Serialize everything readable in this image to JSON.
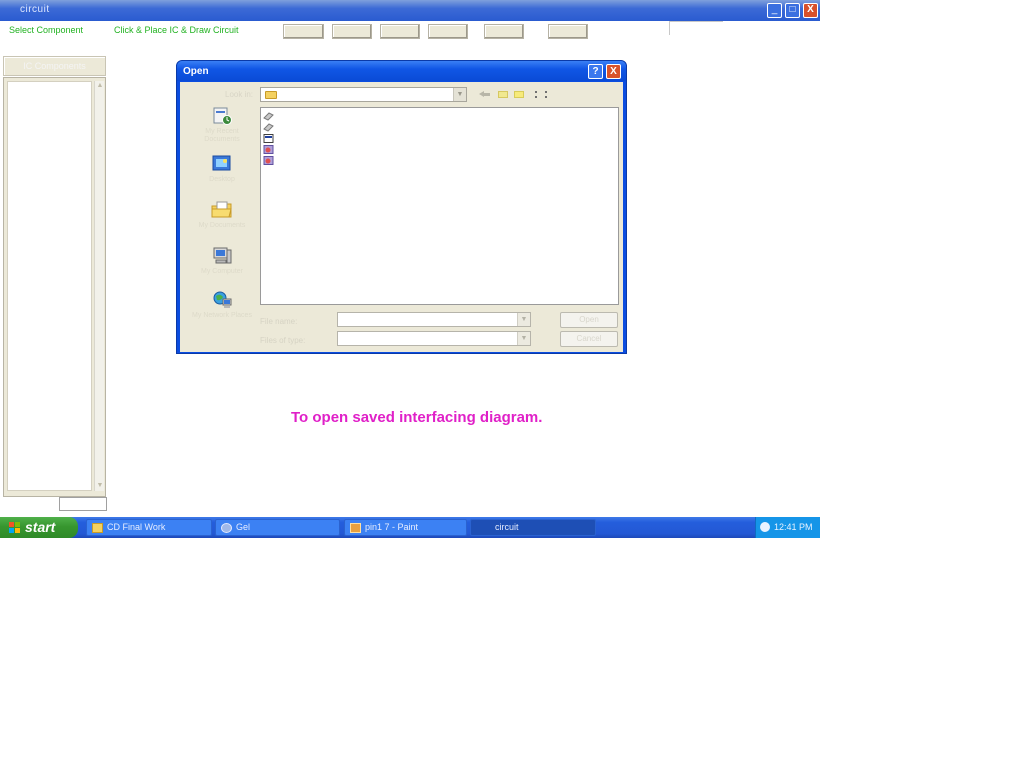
{
  "app": {
    "title": "circuit",
    "select_component_label": "Select Component",
    "click_place_label": "Click & Place IC & Draw Circuit",
    "left_panel_header": "IC Components",
    "min_glyph": "_",
    "max_glyph": "□",
    "close_glyph": "X"
  },
  "dialog": {
    "title": "Open",
    "help_glyph": "?",
    "close_glyph": "X",
    "look_in_label": "Look in:",
    "look_in_value": "",
    "places": [
      {
        "label": "My Recent Documents",
        "icon": "recent-documents-icon"
      },
      {
        "label": "Desktop",
        "icon": "desktop-icon"
      },
      {
        "label": "My Documents",
        "icon": "my-documents-icon"
      },
      {
        "label": "My Computer",
        "icon": "my-computer-icon"
      },
      {
        "label": "My Network Places",
        "icon": "network-places-icon"
      }
    ],
    "files": [
      {
        "name": "",
        "icon": "file-icon"
      },
      {
        "name": "",
        "icon": "file-icon"
      },
      {
        "name": "",
        "icon": "image-file-icon"
      },
      {
        "name": "",
        "icon": "diagram-file-icon"
      },
      {
        "name": "",
        "icon": "diagram-file-icon"
      }
    ],
    "file_name_label": "File name:",
    "file_name_value": "",
    "file_type_label": "Files of type:",
    "file_type_value": "",
    "open_button": "Open",
    "cancel_button": "Cancel"
  },
  "taskbar": {
    "start_label": "start",
    "tasks": [
      {
        "label": "CD Final Work",
        "icon": "folder-icon",
        "active": false
      },
      {
        "label": "Gel",
        "icon": "program-icon",
        "active": false
      },
      {
        "label": "pin1 7 - Paint",
        "icon": "paint-icon",
        "active": false
      },
      {
        "label": "circuit",
        "icon": "app-icon",
        "active": true
      }
    ],
    "clock": "12:41 PM"
  },
  "caption": "To open saved interfacing diagram.",
  "colors": {
    "caption": "#e020c8",
    "menu_text": "#22b222",
    "titlebar": "#2a5bd0",
    "taskbar": "#245edc",
    "start_button": "#37962f"
  }
}
